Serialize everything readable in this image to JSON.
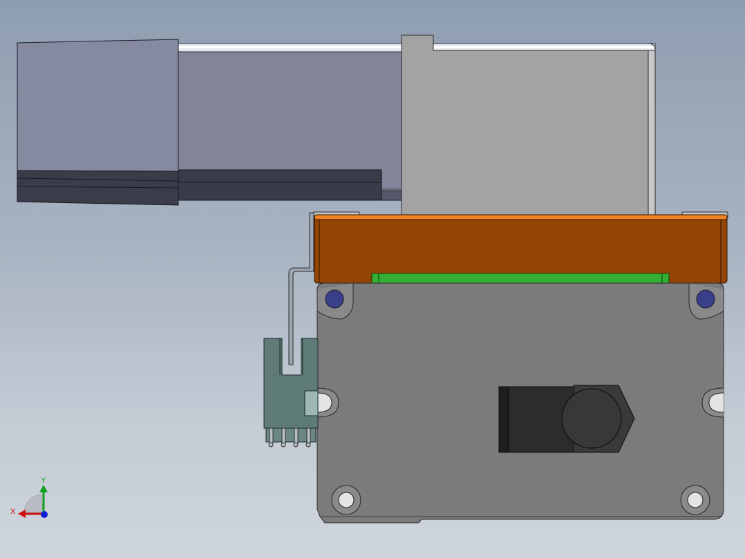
{
  "app": {
    "view": "cad-3d-viewport",
    "background_top": "#8e9db0",
    "background_bottom": "#cfd5dd"
  },
  "triad": {
    "x_label": "X",
    "y_label": "Y",
    "x_color": "#d01010",
    "y_color": "#10a020",
    "z_color": "#1020d0"
  },
  "colors": {
    "motor_body": "#828599",
    "motor_strip": "#3a3b48",
    "rail_cover": "#a3a3a3",
    "carriage_orange": "#934603",
    "carriage_edge": "#f08020",
    "pcb_green": "#33b033",
    "plate_grey": "#7b7b7b",
    "sensor_teal": "#5e7b78",
    "connector_black": "#2c2c2c",
    "screw_blue": "#3a3f8a"
  }
}
